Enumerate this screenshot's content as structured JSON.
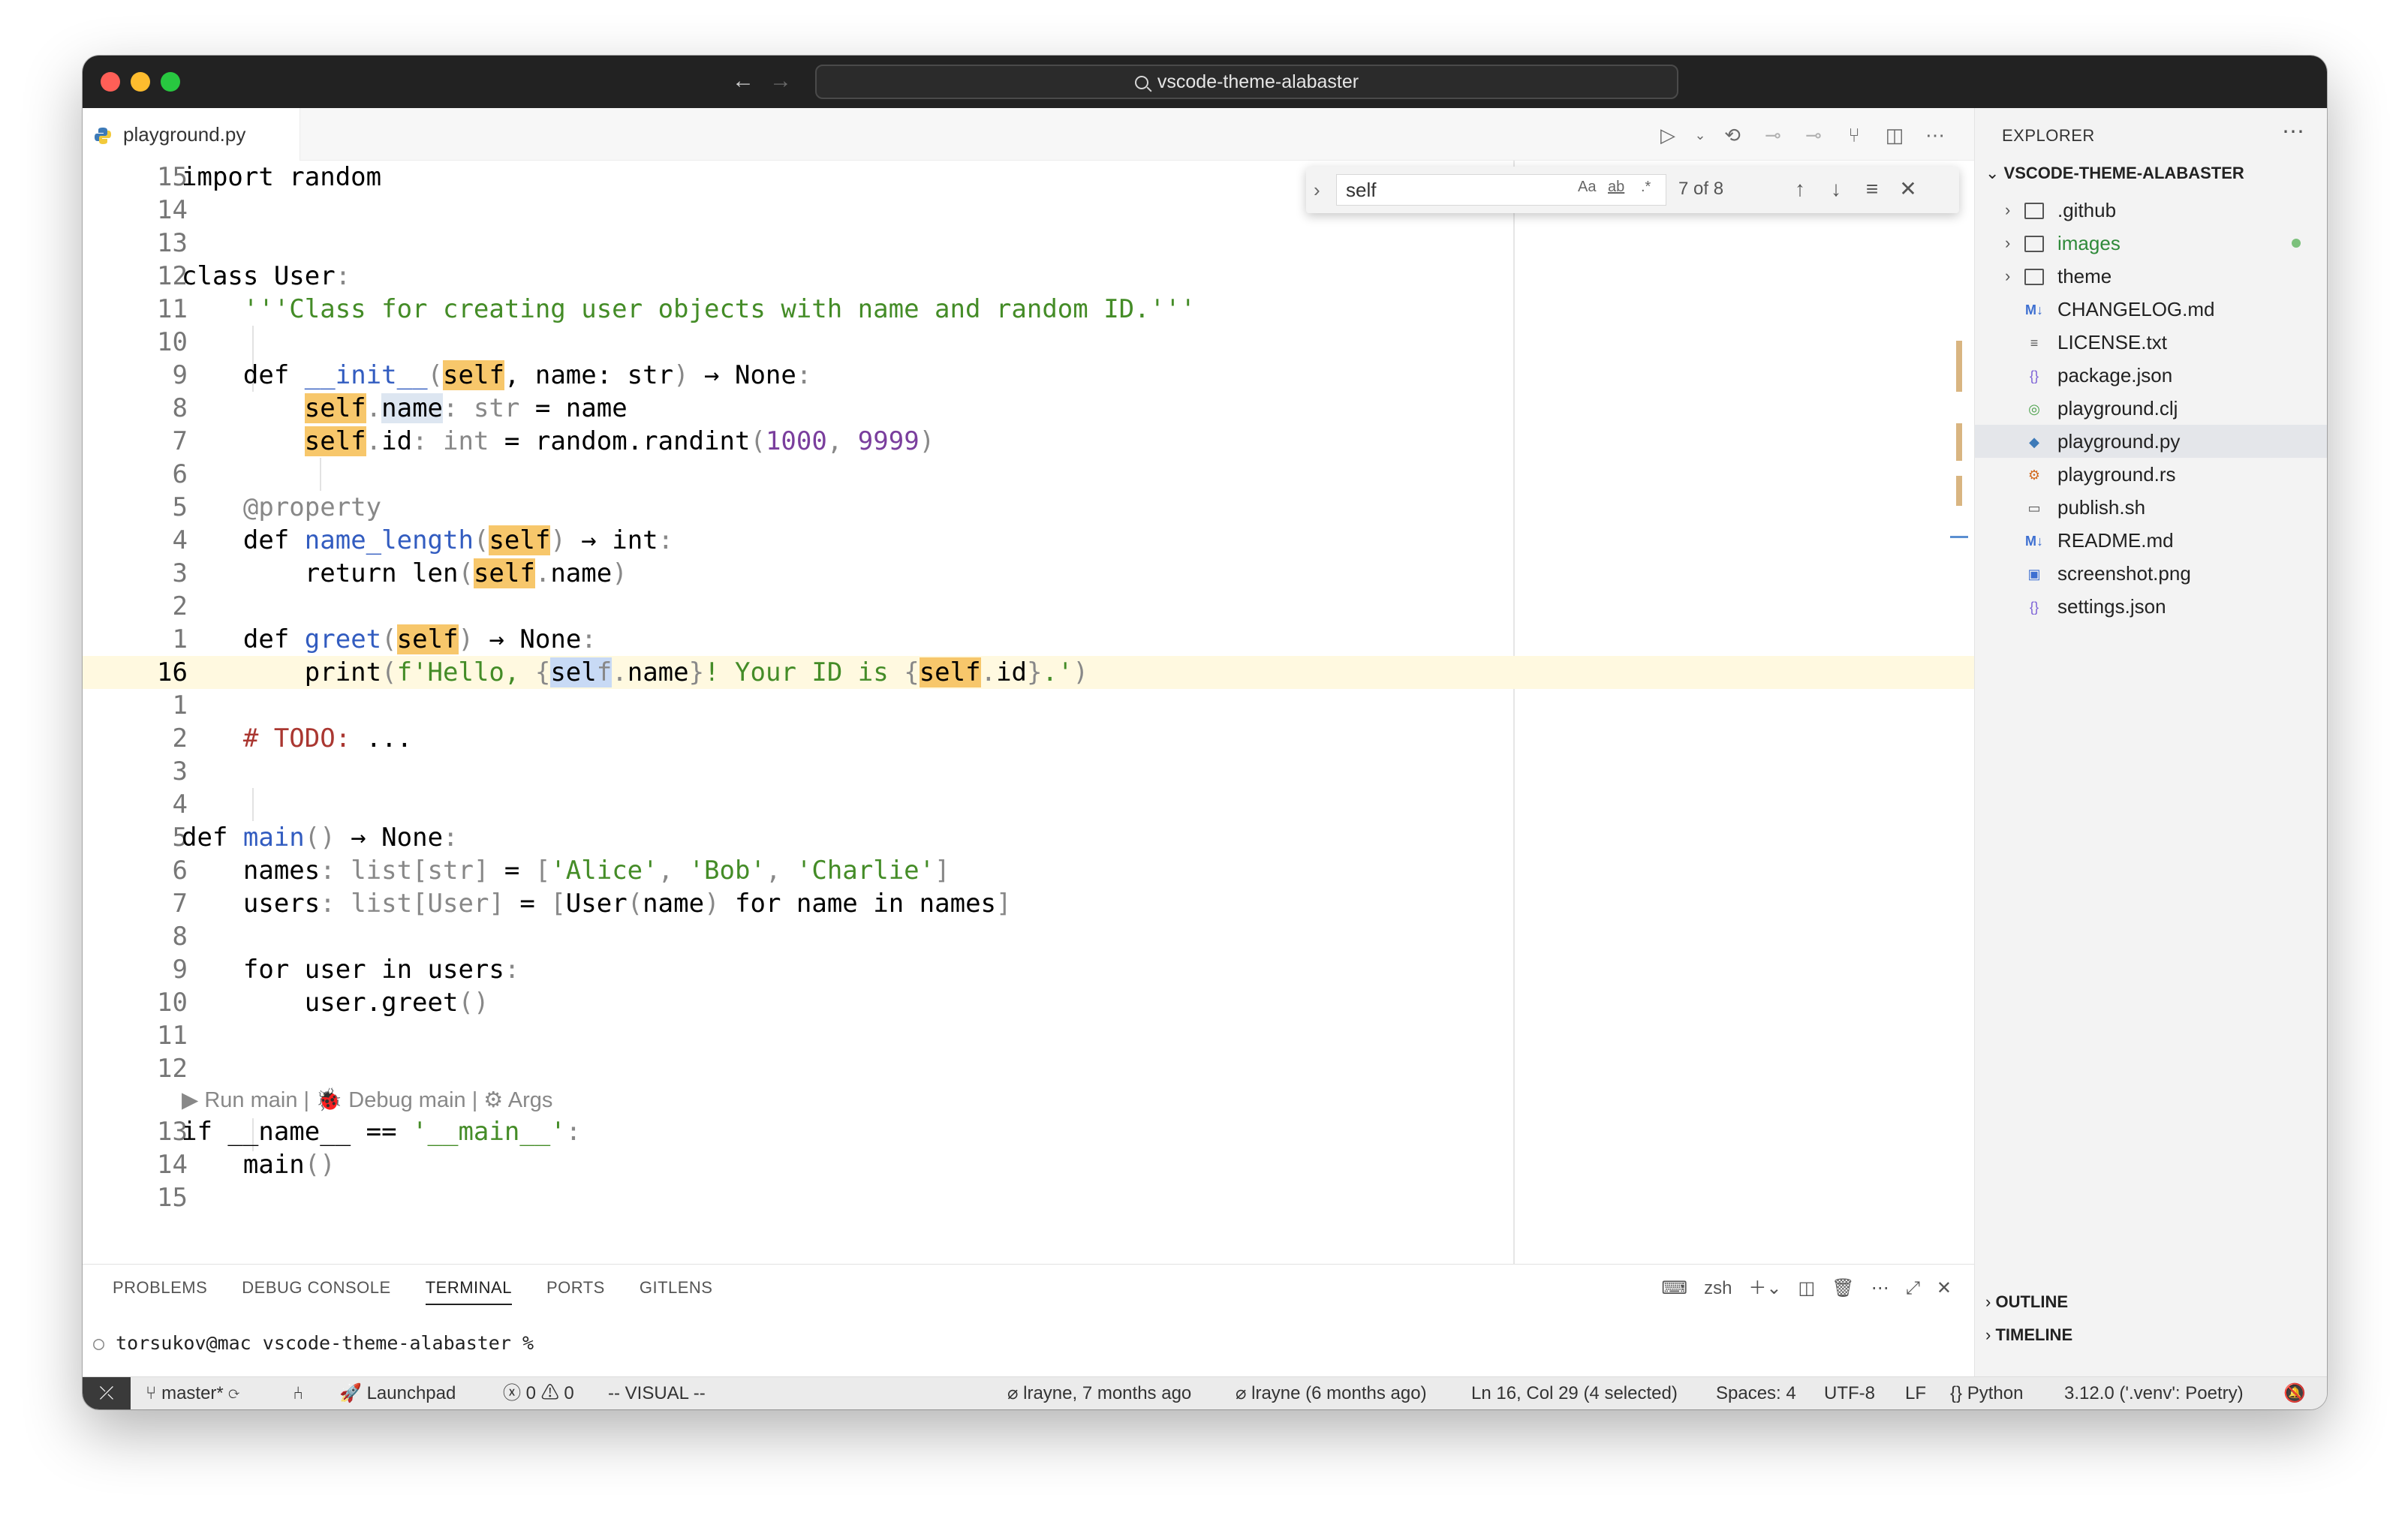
{
  "titlebar": {
    "search_text": "vscode-theme-alabaster"
  },
  "tab": {
    "label": "playground.py"
  },
  "find": {
    "query": "self",
    "count": "7 of 8",
    "opt_case": "Aa",
    "opt_word": "ab",
    "opt_regex": ".*"
  },
  "code": {
    "ln": [
      "15",
      "14",
      "13",
      "12",
      "11",
      "10",
      "9",
      "8",
      "7",
      "6",
      "5",
      "4",
      "3",
      "2",
      "1",
      "16",
      "1",
      "2",
      "3",
      "4",
      "5",
      "6",
      "7",
      "8",
      "9",
      "10",
      "11",
      "12",
      "13",
      "14",
      "15"
    ],
    "codelens": "▶ Run main | 🐞 Debug main | ⚙ Args",
    "t": {
      "import": "import random",
      "class_kw": "class User",
      "colon": ":",
      "docstring": "'''Class for creating user objects with name and random ID.'''",
      "def_kw": "def ",
      "init_name": "__init__",
      "lp": "(",
      "rp": ")",
      "self": "self",
      "init_rest": ", name: str",
      "arrow_none": " → None",
      "self_dot": ".",
      "name": "name",
      "type_str": ": str",
      "eq_name": " = name",
      "id": "id",
      "type_int": ": int",
      "eq_random": " = random.randint",
      "num1": "1000",
      "comma": ", ",
      "num2": "9999",
      "decorator": "@property",
      "name_length": "name_length",
      "arrow_int": " → int",
      "return_len": "return len",
      "greet": "greet",
      "print": "print",
      "fstr_open": "f'Hello, ",
      "lb": "{",
      "rb": "}",
      "sel_part": "sel",
      "f_part": "f",
      "fstr_mid": "! Your ID is ",
      "fstr_end": ".'",
      "todo": "# TODO:",
      "ellipsis": "...",
      "main_def": "main",
      "names_var": "names",
      "list_str": ": list[str]",
      "eq": " = ",
      "lbr": "[",
      "rbr": "]",
      "alice": "'Alice'",
      "bob": "'Bob'",
      "charlie": "'Charlie'",
      "users_var": "users",
      "list_user": ": list[User]",
      "user_ctor": "User",
      "comp_rest": " for name in names",
      "for_kw": "for user in users",
      "user_greet": "user.greet",
      "if_name": "if __name__ == ",
      "main_str": "'__main__'",
      "main_call": "main"
    }
  },
  "panel": {
    "tabs": [
      "PROBLEMS",
      "DEBUG CONSOLE",
      "TERMINAL",
      "PORTS",
      "GITLENS"
    ],
    "shell": "zsh",
    "prompt": "torsukov@mac vscode-theme-alabaster %"
  },
  "sidebar": {
    "title": "EXPLORER",
    "root": "VSCODE-THEME-ALABASTER",
    "folders": [
      ".github",
      "images",
      "theme"
    ],
    "files": [
      "CHANGELOG.md",
      "LICENSE.txt",
      "package.json",
      "playground.clj",
      "playground.py",
      "playground.rs",
      "publish.sh",
      "README.md",
      "screenshot.png",
      "settings.json"
    ],
    "outline": "OUTLINE",
    "timeline": "TIMELINE"
  },
  "status": {
    "branch": "master*",
    "launchpad": "Launchpad",
    "errors": "0",
    "warnings": "0",
    "mode": "-- VISUAL --",
    "blame": "lrayne, 7 months ago",
    "blame2": "lrayne (6 months ago)",
    "position": "Ln 16, Col 29 (4 selected)",
    "spaces": "Spaces: 4",
    "encoding": "UTF-8",
    "eol": "LF",
    "language": "Python",
    "interpreter": "3.12.0 ('.venv': Poetry)"
  },
  "colors": {
    "highlight": "#f7c76b",
    "string": "#448c27",
    "number": "#7a3e9d",
    "definition": "#325cc0",
    "comment": "#aa3731"
  }
}
